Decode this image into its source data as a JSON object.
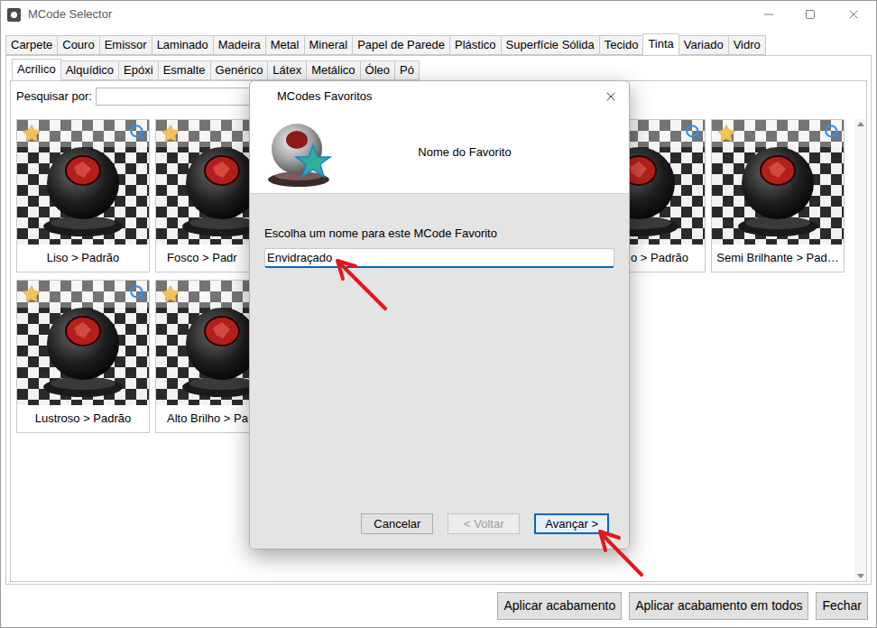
{
  "window": {
    "title": "MCode Selector"
  },
  "categories": [
    {
      "label": "Carpete",
      "selected": false
    },
    {
      "label": "Couro",
      "selected": false
    },
    {
      "label": "Emissor",
      "selected": false
    },
    {
      "label": "Laminado",
      "selected": false
    },
    {
      "label": "Madeira",
      "selected": false
    },
    {
      "label": "Metal",
      "selected": false
    },
    {
      "label": "Mineral",
      "selected": false
    },
    {
      "label": "Papel de Parede",
      "selected": false
    },
    {
      "label": "Plástico",
      "selected": false
    },
    {
      "label": "Superfície Sólida",
      "selected": false
    },
    {
      "label": "Tecido",
      "selected": false
    },
    {
      "label": "Tinta",
      "selected": true
    },
    {
      "label": "Variado",
      "selected": false
    },
    {
      "label": "Vidro",
      "selected": false
    }
  ],
  "subcategories": [
    {
      "label": "Acrílico",
      "selected": true
    },
    {
      "label": "Alquídico",
      "selected": false
    },
    {
      "label": "Epóxi",
      "selected": false
    },
    {
      "label": "Esmalte",
      "selected": false
    },
    {
      "label": "Genérico",
      "selected": false
    },
    {
      "label": "Látex",
      "selected": false
    },
    {
      "label": "Metálico",
      "selected": false
    },
    {
      "label": "Óleo",
      "selected": false
    },
    {
      "label": "Pó",
      "selected": false
    }
  ],
  "search": {
    "label": "Pesquisar por:",
    "value": ""
  },
  "cards": [
    {
      "label": "Liso > Padrão"
    },
    {
      "label": "Fosco > Padr"
    },
    {
      "label": ""
    },
    {
      "label": ""
    },
    {
      "label": "o > Padrão"
    },
    {
      "label": "Semi Brilhante > Pad…"
    },
    {
      "label": "Lustroso > Padrão"
    },
    {
      "label": "Alto Brilho > Pa"
    }
  ],
  "footer_buttons": [
    "Aplicar acabamento",
    "Aplicar acabamento em todos",
    "Fechar"
  ],
  "dialog": {
    "title": "MCodes Favoritos",
    "heading": "Nome do Favorito",
    "prompt": "Escolha um nome para este MCode Favorito",
    "name": "Envidraçado",
    "buttons": [
      {
        "label": "Cancelar",
        "disabled": false,
        "focused": false
      },
      {
        "label": "< Voltar",
        "disabled": true,
        "focused": false
      },
      {
        "label": "Avançar >",
        "disabled": false,
        "focused": true
      }
    ]
  }
}
